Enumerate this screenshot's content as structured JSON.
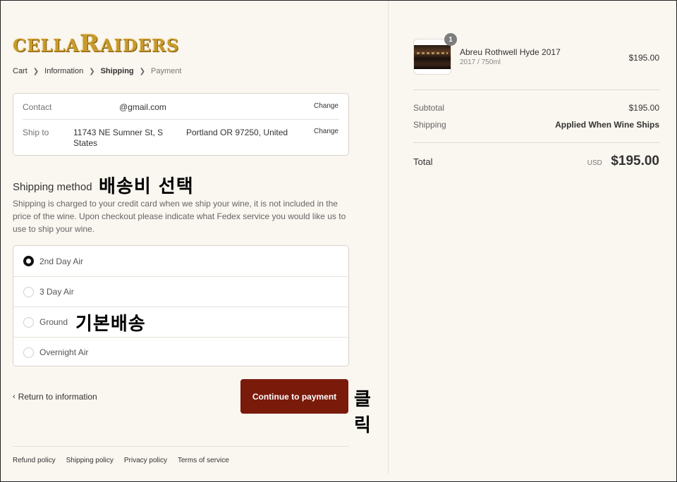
{
  "brand": {
    "logo_text_1": "CELLA",
    "logo_text_2": "R",
    "logo_text_3": "AIDERS"
  },
  "breadcrumb": {
    "items": [
      "Cart",
      "Information",
      "Shipping",
      "Payment"
    ],
    "current": "Shipping"
  },
  "review": {
    "contact_label": "Contact",
    "contact_value": "@gmail.com",
    "contact_change": "Change",
    "shipto_label": "Ship to",
    "shipto_value_line1": "11743 NE Sumner St, S",
    "shipto_value_line2": "States",
    "shipto_value_city": "Portland OR 97250, United",
    "shipto_change": "Change"
  },
  "shipping": {
    "title": "Shipping method",
    "annotation": "배송비 선택",
    "description": "Shipping is charged to your credit card when we ship your wine, it is not included in the price of the wine. Upon checkout please indicate what Fedex service you would like us to use to ship your wine.",
    "methods": [
      {
        "label": "2nd Day Air",
        "selected": true
      },
      {
        "label": "3 Day Air",
        "selected": false
      },
      {
        "label": "Ground",
        "selected": false
      },
      {
        "label": "Overnight Air",
        "selected": false
      }
    ],
    "ground_annotation": "기본배송"
  },
  "actions": {
    "back_label": "Return to information",
    "continue_label": "Continue to payment",
    "continue_annotation": "클릭",
    "continue_color": "#7a1a0b"
  },
  "footer": {
    "links": [
      "Refund policy",
      "Shipping policy",
      "Privacy policy",
      "Terms of service"
    ]
  },
  "summary": {
    "product_name": "Abreu Rothwell Hyde 2017",
    "product_meta": "2017 / 750ml",
    "product_price": "$195.00",
    "quantity": "1",
    "subtotal_label": "Subtotal",
    "subtotal_value": "$195.00",
    "shipping_label": "Shipping",
    "shipping_value": "Applied When Wine Ships",
    "total_label": "Total",
    "currency": "USD",
    "total_value": "$195.00"
  }
}
